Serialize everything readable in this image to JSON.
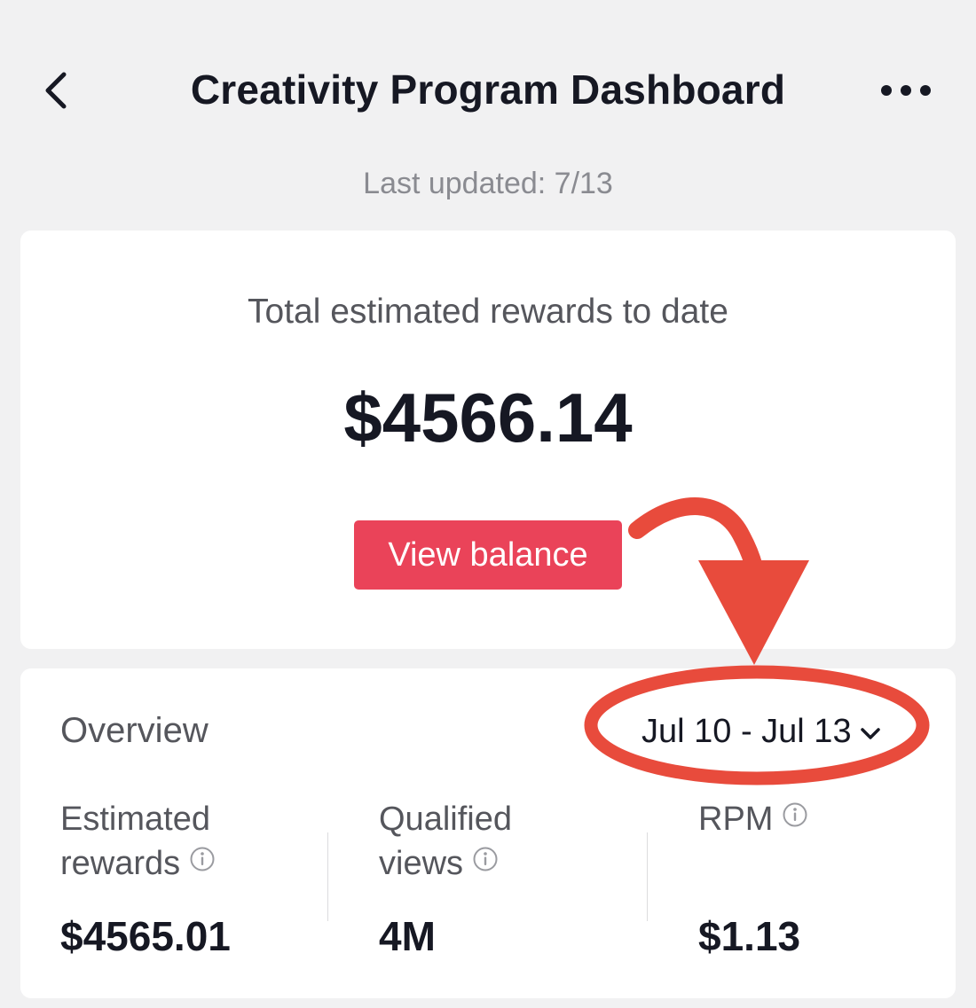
{
  "header": {
    "title": "Creativity Program Dashboard",
    "back_icon": "chevron-left-icon",
    "more_icon": "more-horizontal-icon"
  },
  "last_updated": "Last updated: 7/13",
  "rewards": {
    "label": "Total estimated rewards to date",
    "value": "$4566.14",
    "button_label": "View balance"
  },
  "overview": {
    "title": "Overview",
    "date_range": "Jul 10 - Jul 13",
    "metrics": [
      {
        "label_line1": "Estimated",
        "label_line2": "rewards",
        "value": "$4565.01"
      },
      {
        "label_line1": "Qualified",
        "label_line2": "views",
        "value": "4M"
      },
      {
        "label_line1": "RPM",
        "label_line2": "",
        "value": "$1.13"
      }
    ]
  },
  "colors": {
    "background": "#f1f1f2",
    "card": "#ffffff",
    "primary_button": "#ea4359",
    "annotation_red": "#e84b3c",
    "text_primary": "#161823",
    "text_secondary": "#55565c"
  }
}
